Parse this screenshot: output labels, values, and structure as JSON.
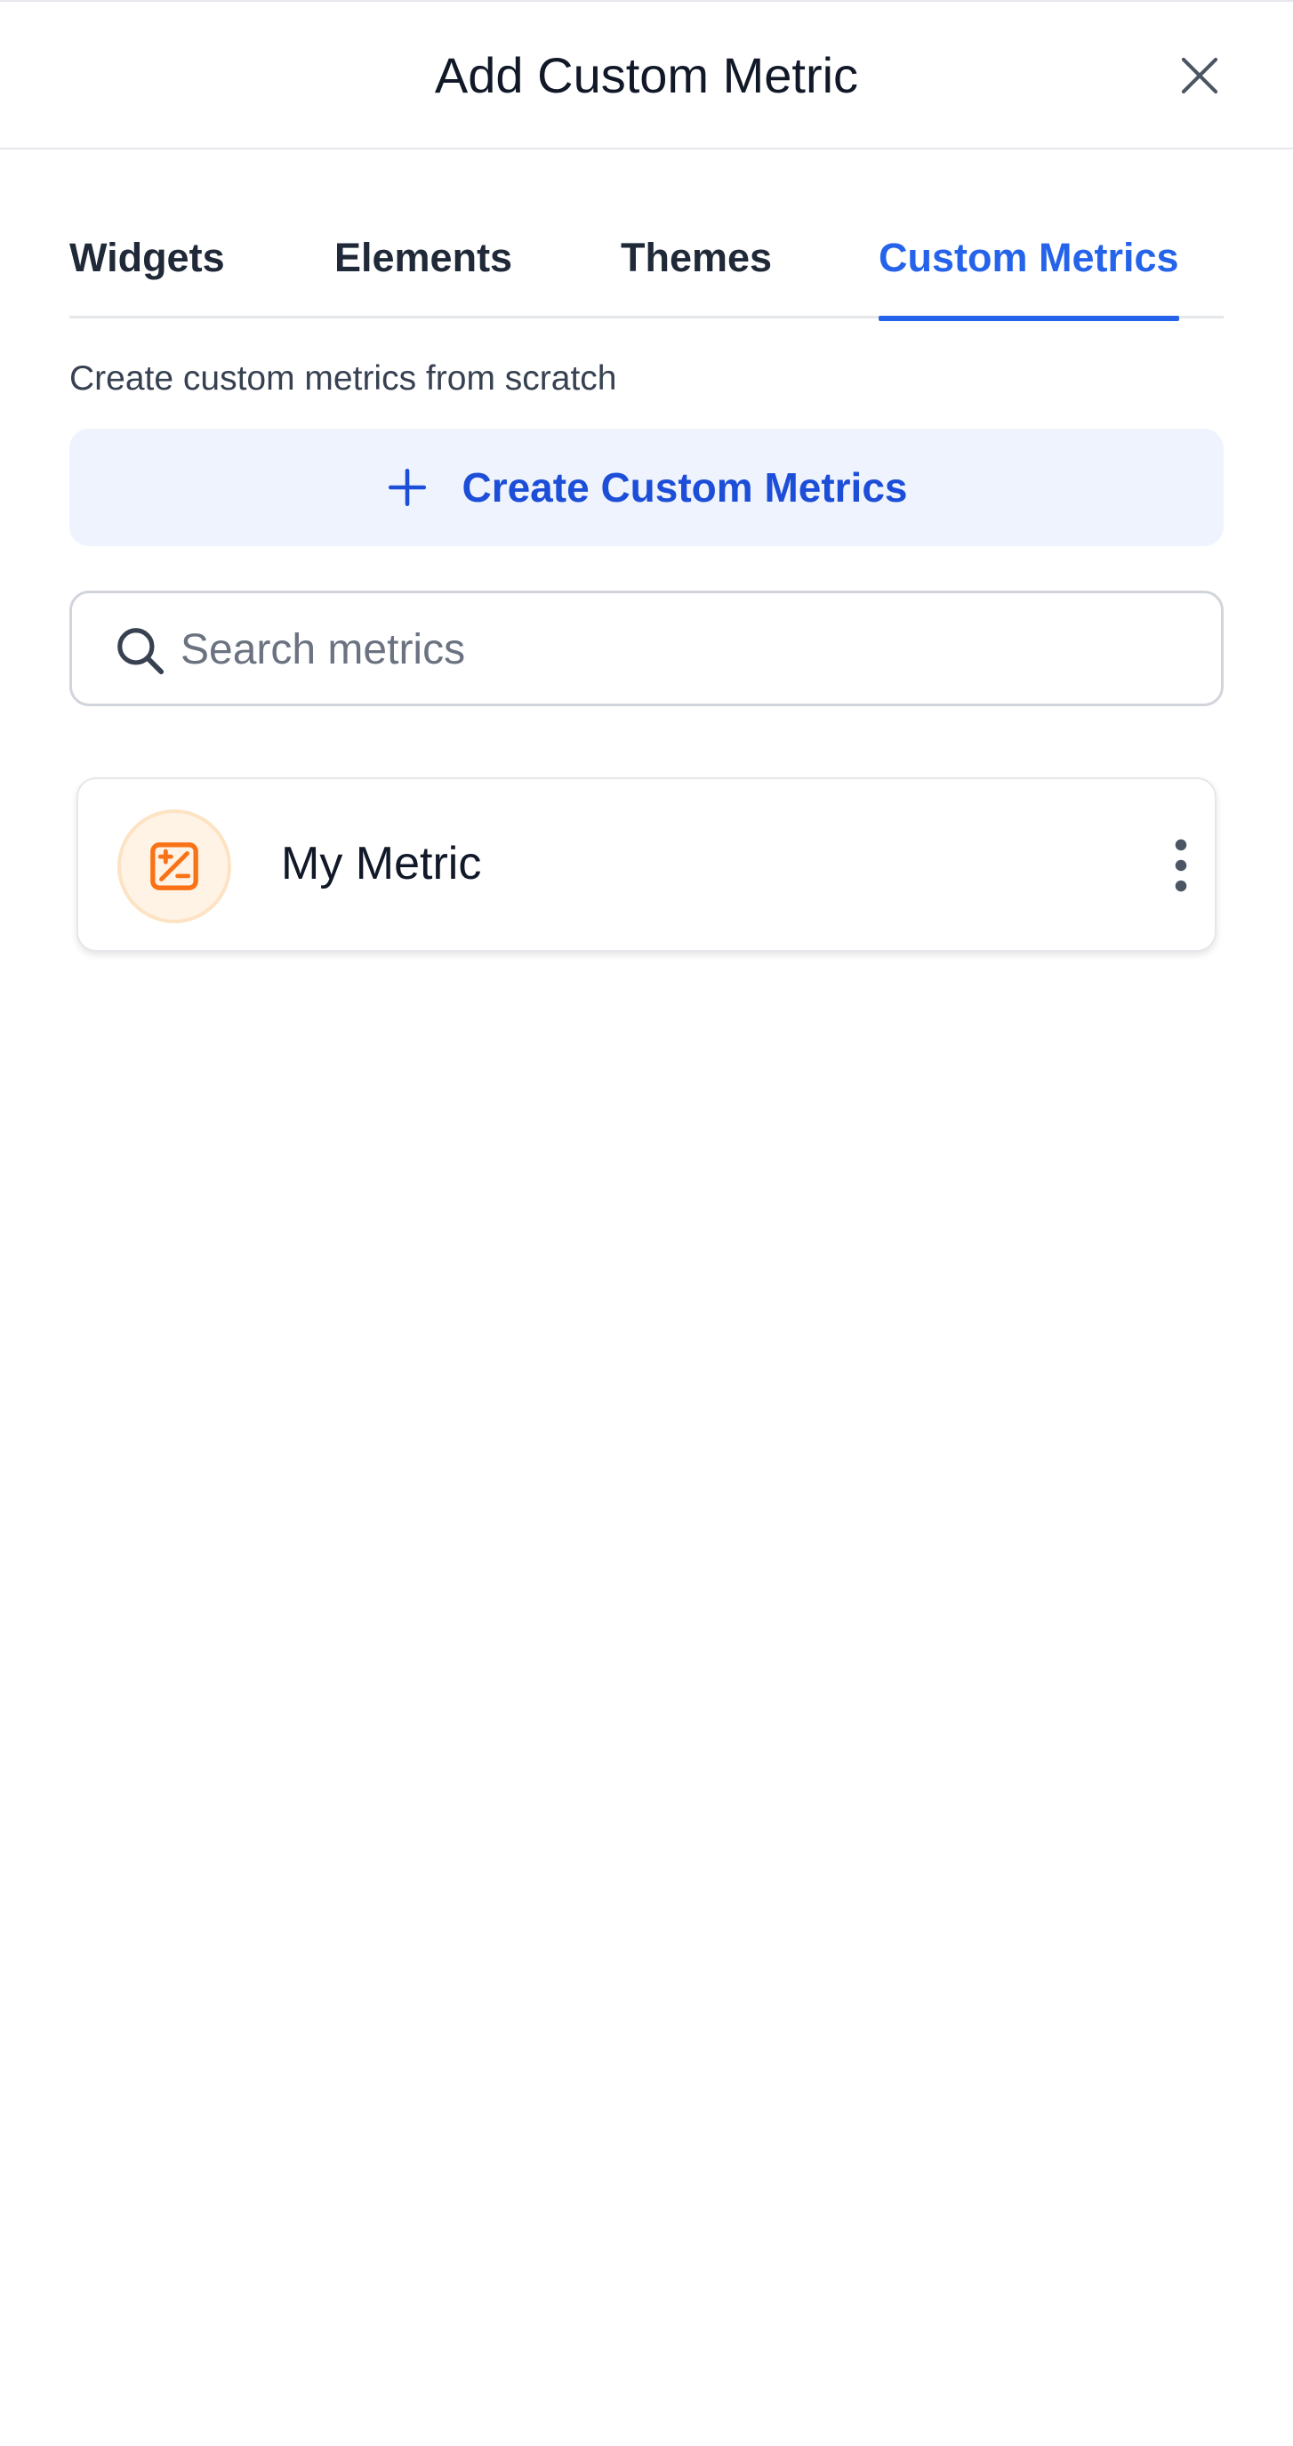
{
  "header": {
    "title": "Add Custom Metric",
    "close_icon": "close-icon"
  },
  "tabs": [
    {
      "label": "Widgets",
      "active": false
    },
    {
      "label": "Elements",
      "active": false
    },
    {
      "label": "Themes",
      "active": false
    },
    {
      "label": "Custom Metrics",
      "active": true
    }
  ],
  "custom_metrics": {
    "hint": "Create custom metrics from scratch",
    "create_button_label": "Create Custom Metrics",
    "create_button_icon": "plus-icon",
    "search": {
      "placeholder": "Search metrics",
      "value": "",
      "icon": "search-icon"
    },
    "items": [
      {
        "name": "My Metric",
        "icon": "calculator-icon",
        "menu_icon": "more-vertical-icon"
      }
    ]
  },
  "colors": {
    "accent": "#2563eb",
    "accent_light_bg": "#eef3fd",
    "metric_icon": "#f97316",
    "metric_icon_bg": "#fff3e6"
  }
}
